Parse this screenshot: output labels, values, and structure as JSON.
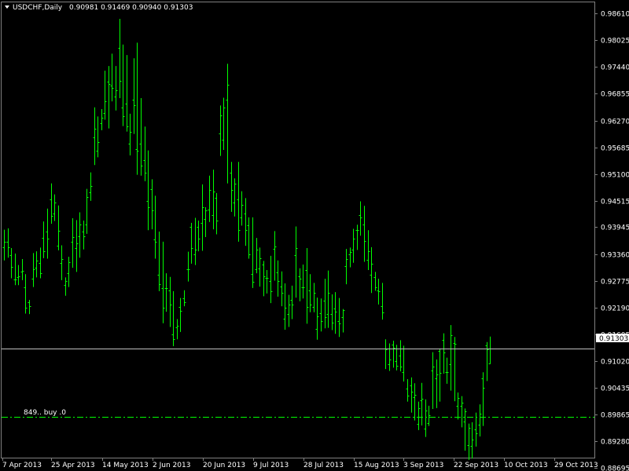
{
  "header": {
    "symbol_timeframe": "USDCHF,Daily",
    "ohlc": "0.90981 0.91469 0.90940 0.91303"
  },
  "colors": {
    "background": "#000000",
    "bars": "#00ff00",
    "grid": "#808080",
    "bid_line": "#c0c0c0",
    "order_line": "#00ff00"
  },
  "bid": {
    "label": "0.91303",
    "value": 0.91303
  },
  "order": {
    "label": "849..  buy  .0",
    "price": 0.8949
  },
  "chart_data": {
    "type": "ohlc",
    "title": "USDCHF,Daily",
    "ylim": [
      0.8867,
      0.9885
    ],
    "y_ticks": [
      "0.98610",
      "0.98025",
      "0.97440",
      "0.96855",
      "0.96270",
      "0.95685",
      "0.95100",
      "0.94515",
      "0.93945",
      "0.93360",
      "0.92775",
      "0.92190",
      "0.91605",
      "0.91020",
      "0.90435",
      "0.89865",
      "0.89280",
      "0.88695"
    ],
    "x_ticks": [
      "7 Apr 2013",
      "25 Apr 2013",
      "14 May 2013",
      "2 Jun 2013",
      "20 Jun 2013",
      "9 Jul 2013",
      "28 Jul 2013",
      "15 Aug 2013",
      "3 Sep 2013",
      "22 Sep 2013",
      "10 Oct 2013",
      "29 Oct 2013"
    ],
    "bars_high": [
      0.9389,
      0.9392,
      0.9349,
      0.9337,
      0.9312,
      0.9325,
      0.9292,
      0.9236,
      0.9338,
      0.9342,
      0.935,
      0.9407,
      0.9435,
      0.949,
      0.9466,
      0.9442,
      0.9355,
      0.9285,
      0.933,
      0.9414,
      0.941,
      0.9427,
      0.9409,
      0.9478,
      0.9514,
      0.9656,
      0.9636,
      0.9652,
      0.9736,
      0.9746,
      0.9773,
      0.9746,
      0.9849,
      0.9793,
      0.977,
      0.9642,
      0.9763,
      0.9797,
      0.9676,
      0.9614,
      0.9562,
      0.9499,
      0.9463,
      0.9385,
      0.9363,
      0.9294,
      0.9286,
      0.9255,
      0.9194,
      0.924,
      0.9257,
      0.9341,
      0.9404,
      0.9415,
      0.9409,
      0.9488,
      0.9438,
      0.9507,
      0.952,
      0.9469,
      0.966,
      0.9677,
      0.9751,
      0.9537,
      0.9501,
      0.9537,
      0.9473,
      0.9458,
      0.9416,
      0.9416,
      0.9371,
      0.935,
      0.9321,
      0.9301,
      0.9332,
      0.9386,
      0.9322,
      0.9298,
      0.9272,
      0.9247,
      0.9267,
      0.9396,
      0.9305,
      0.9313,
      0.9349,
      0.9292,
      0.9273,
      0.9241,
      0.9239,
      0.9282,
      0.93,
      0.9248,
      0.9253,
      0.924,
      0.9216,
      0.9347,
      0.935,
      0.9391,
      0.94,
      0.9451,
      0.9441,
      0.9388,
      0.9351,
      0.9297,
      0.9282,
      0.9273,
      0.915,
      0.9141,
      0.9147,
      0.9138,
      0.9148,
      0.9136,
      0.9063,
      0.9067,
      0.9054,
      0.9014,
      0.9055,
      0.9019,
      0.9005,
      0.9122,
      0.9106,
      0.913,
      0.9163,
      0.911,
      0.9181,
      0.9155,
      0.9034,
      0.9026,
      0.8999,
      0.8966,
      0.8969,
      0.899,
      0.9008,
      0.9078,
      0.9144,
      0.9156
    ],
    "bars_low": [
      0.9322,
      0.9328,
      0.9283,
      0.9268,
      0.9268,
      0.9279,
      0.9206,
      0.9205,
      0.9264,
      0.9285,
      0.9283,
      0.9327,
      0.9326,
      0.9402,
      0.9408,
      0.9344,
      0.9279,
      0.9245,
      0.9264,
      0.9306,
      0.9297,
      0.9328,
      0.9346,
      0.938,
      0.9452,
      0.953,
      0.9547,
      0.9606,
      0.9629,
      0.961,
      0.9669,
      0.9649,
      0.9676,
      0.9615,
      0.9603,
      0.9551,
      0.9598,
      0.9509,
      0.9507,
      0.9495,
      0.9388,
      0.939,
      0.9326,
      0.9255,
      0.9185,
      0.921,
      0.9177,
      0.9135,
      0.915,
      0.9166,
      0.9222,
      0.9276,
      0.9315,
      0.9312,
      0.9342,
      0.9343,
      0.9373,
      0.9406,
      0.939,
      0.9379,
      0.955,
      0.9563,
      0.949,
      0.9428,
      0.9418,
      0.9363,
      0.9398,
      0.9354,
      0.9326,
      0.9262,
      0.9294,
      0.9265,
      0.9244,
      0.925,
      0.9229,
      0.9278,
      0.9243,
      0.9222,
      0.9171,
      0.9177,
      0.9194,
      0.9241,
      0.9233,
      0.9239,
      0.9184,
      0.9209,
      0.9209,
      0.9149,
      0.9167,
      0.9174,
      0.9175,
      0.917,
      0.9162,
      0.9155,
      0.9165,
      0.927,
      0.9307,
      0.9317,
      0.9345,
      0.9376,
      0.9319,
      0.9301,
      0.9251,
      0.9256,
      0.9226,
      0.9193,
      0.9085,
      0.9081,
      0.9088,
      0.9082,
      0.908,
      0.9058,
      0.9014,
      0.899,
      0.8973,
      0.8952,
      0.8962,
      0.8937,
      0.8961,
      0.8998,
      0.9,
      0.9014,
      0.9075,
      0.9053,
      0.9038,
      0.9015,
      0.8975,
      0.8958,
      0.8907,
      0.8887,
      0.889,
      0.8916,
      0.8938,
      0.8961,
      0.9059,
      0.9096
    ],
    "bars_open": [
      0.935,
      0.9363,
      0.9333,
      0.9281,
      0.9285,
      0.9298,
      0.9264,
      0.9231,
      0.9283,
      0.9306,
      0.9316,
      0.9372,
      0.9385,
      0.9456,
      0.9424,
      0.9355,
      0.9317,
      0.9268,
      0.9294,
      0.9363,
      0.9349,
      0.9375,
      0.9385,
      0.94,
      0.9471,
      0.9591,
      0.9562,
      0.9621,
      0.9643,
      0.9712,
      0.9703,
      0.968,
      0.9786,
      0.9655,
      0.9664,
      0.9577,
      0.9672,
      0.9564,
      0.9577,
      0.954,
      0.9452,
      0.9478,
      0.9367,
      0.929,
      0.9261,
      0.9262,
      0.9257,
      0.9161,
      0.9176,
      0.9221,
      0.9239,
      0.9303,
      0.9395,
      0.9335,
      0.9395,
      0.9403,
      0.9412,
      0.9433,
      0.9421,
      0.9459,
      0.9599,
      0.9585,
      0.9672,
      0.9513,
      0.9449,
      0.9455,
      0.9416,
      0.9425,
      0.9398,
      0.9293,
      0.9303,
      0.9305,
      0.9313,
      0.9284,
      0.9277,
      0.9348,
      0.9296,
      0.9265,
      0.9195,
      0.9206,
      0.9236,
      0.9334,
      0.9287,
      0.9263,
      0.9301,
      0.9256,
      0.9221,
      0.9173,
      0.9207,
      0.9234,
      0.9205,
      0.9206,
      0.9217,
      0.9189,
      0.9199,
      0.931,
      0.9336,
      0.9346,
      0.9389,
      0.9421,
      0.94,
      0.9323,
      0.929,
      0.9286,
      0.9256,
      0.9222,
      0.9129,
      0.9096,
      0.9139,
      0.9102,
      0.9114,
      0.9079,
      0.9043,
      0.9049,
      0.9023,
      0.8966,
      0.9016,
      0.8955,
      0.8968,
      0.9082,
      0.9065,
      0.9124,
      0.9148,
      0.9078,
      0.9095,
      0.9141,
      0.9005,
      0.9005,
      0.897,
      0.892,
      0.8917,
      0.8954,
      0.8963,
      0.9064,
      0.9137,
      0.9098
    ],
    "bars_close": [
      0.9362,
      0.935,
      0.9308,
      0.928,
      0.9288,
      0.9299,
      0.9219,
      0.9223,
      0.9302,
      0.9322,
      0.9294,
      0.9343,
      0.9369,
      0.942,
      0.9448,
      0.9386,
      0.9325,
      0.9277,
      0.9319,
      0.9373,
      0.9359,
      0.94,
      0.9375,
      0.946,
      0.9484,
      0.961,
      0.958,
      0.9634,
      0.9669,
      0.9707,
      0.9698,
      0.9693,
      0.9713,
      0.9637,
      0.9614,
      0.9603,
      0.966,
      0.9562,
      0.9528,
      0.9513,
      0.9438,
      0.9432,
      0.9362,
      0.927,
      0.9219,
      0.9262,
      0.9225,
      0.9151,
      0.9179,
      0.9212,
      0.9231,
      0.9302,
      0.9349,
      0.9346,
      0.9369,
      0.9438,
      0.9431,
      0.9475,
      0.9473,
      0.9409,
      0.9638,
      0.9655,
      0.9706,
      0.9476,
      0.949,
      0.9389,
      0.9444,
      0.9389,
      0.9335,
      0.9276,
      0.9345,
      0.9326,
      0.9287,
      0.9284,
      0.9255,
      0.9353,
      0.9277,
      0.9251,
      0.9219,
      0.9226,
      0.9226,
      0.9349,
      0.9282,
      0.9264,
      0.922,
      0.9225,
      0.9252,
      0.92,
      0.919,
      0.9199,
      0.9252,
      0.9186,
      0.9211,
      0.9185,
      0.9213,
      0.9325,
      0.9341,
      0.937,
      0.9389,
      0.9416,
      0.9364,
      0.9342,
      0.9315,
      0.9263,
      0.9255,
      0.9209,
      0.9128,
      0.9106,
      0.9131,
      0.9092,
      0.909,
      0.913,
      0.9027,
      0.9035,
      0.9029,
      0.9,
      0.9021,
      0.8994,
      0.8985,
      0.909,
      0.9074,
      0.9076,
      0.9122,
      0.9078,
      0.9159,
      0.914,
      0.9022,
      0.9012,
      0.8993,
      0.8957,
      0.8932,
      0.8945,
      0.8987,
      0.9045,
      0.9128,
      0.913
    ]
  }
}
